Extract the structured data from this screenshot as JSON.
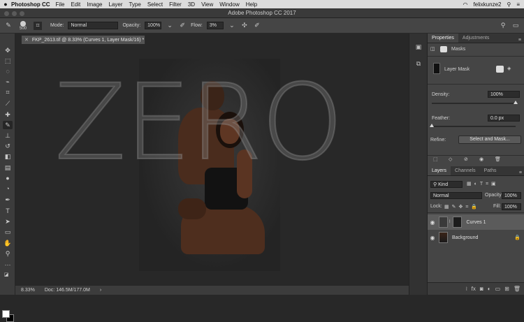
{
  "menubar": {
    "apple_icon": "",
    "app_name": "Photoshop CC",
    "items": [
      "File",
      "Edit",
      "Image",
      "Layer",
      "Type",
      "Select",
      "Filter",
      "3D",
      "View",
      "Window",
      "Help"
    ],
    "user": "felixkunze2"
  },
  "titlebar": {
    "title": "Adobe Photoshop CC 2017"
  },
  "options": {
    "brush_size": "500",
    "mode_label": "Mode:",
    "mode_value": "Normal",
    "opacity_label": "Opacity:",
    "opacity_value": "100%",
    "flow_label": "Flow:",
    "flow_value": "3%"
  },
  "document": {
    "tab_title": "FKP_2613.tif @ 8.33% (Curves 1, Layer Mask/16) *",
    "overlay_text": "ZERO",
    "zoom": "8.33%",
    "doc_size": "Doc: 146.5M/177.0M"
  },
  "properties": {
    "tabs": [
      "Properties",
      "Adjustments"
    ],
    "masks_label": "Masks",
    "layer_mask_label": "Layer Mask",
    "density_label": "Density:",
    "density_value": "100%",
    "density_fraction": 1.0,
    "feather_label": "Feather:",
    "feather_value": "0.0 px",
    "feather_fraction": 0.0,
    "refine_label": "Refine:",
    "select_mask_button": "Select and Mask..."
  },
  "layers": {
    "tabs": [
      "Layers",
      "Channels",
      "Paths"
    ],
    "filter_kind": "Kind",
    "blend_mode": "Normal",
    "opacity_label": "Opacity:",
    "opacity_value": "100%",
    "lock_label": "Lock:",
    "fill_label": "Fill:",
    "fill_value": "100%",
    "items": [
      {
        "name": "Curves 1",
        "selected": true
      },
      {
        "name": "Background",
        "selected": false
      }
    ]
  },
  "colors": {
    "accent": "#5b5b5b",
    "panel": "#454545",
    "canvas": "#282828"
  }
}
